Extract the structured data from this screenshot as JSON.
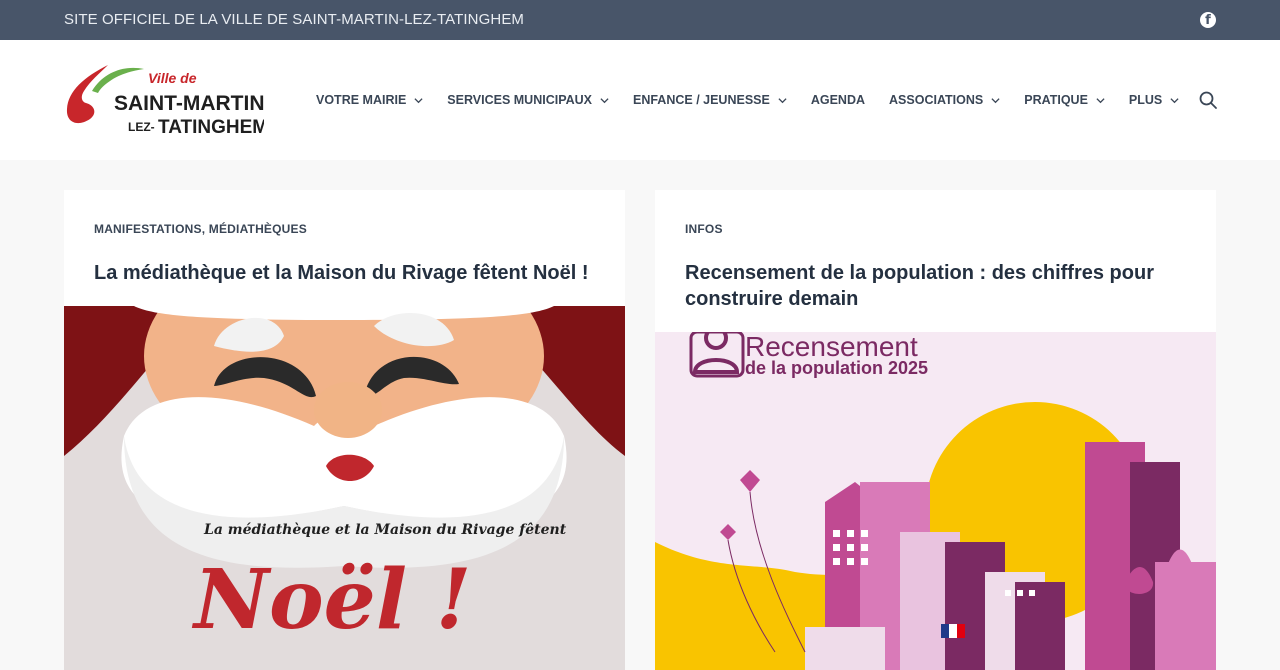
{
  "topbar": {
    "site_title": "SITE OFFICIEL DE LA VILLE DE SAINT-MARTIN-LEZ-TATINGHEM",
    "social_icon": "facebook-icon"
  },
  "header": {
    "logo": {
      "line1": "Ville de",
      "line2": "SAINT-MARTIN",
      "line3_prefix": "LEZ-",
      "line3": "TATINGHEM"
    },
    "nav": [
      {
        "label": "VOTRE MAIRIE",
        "has_dropdown": true
      },
      {
        "label": "SERVICES MUNICIPAUX",
        "has_dropdown": true
      },
      {
        "label": "ENFANCE / JEUNESSE",
        "has_dropdown": true
      },
      {
        "label": "AGENDA",
        "has_dropdown": false
      },
      {
        "label": "ASSOCIATIONS",
        "has_dropdown": true
      },
      {
        "label": "PRATIQUE",
        "has_dropdown": true
      },
      {
        "label": "PLUS",
        "has_dropdown": true
      }
    ],
    "search_icon": "search-icon"
  },
  "posts": [
    {
      "categories": [
        "MANIFESTATIONS",
        "MÉDIATHÈQUES"
      ],
      "separator": ", ",
      "title": "La médiathèque et la Maison du Rivage fêtent Noël !",
      "image": {
        "subtitle": "La médiathèque et la Maison du Rivage fêtent",
        "headline": "Noël !"
      }
    },
    {
      "categories": [
        "INFOS"
      ],
      "title": "Recensement de la population : des chiffres pour construire demain",
      "image": {
        "headline": "Recensement",
        "subline": "de la population 2025"
      }
    }
  ],
  "colors": {
    "topbar": "#485569",
    "logo_red": "#c8262b",
    "logo_green": "#6ab04c",
    "noel_red": "#c0272d",
    "census_purple": "#7b2a63",
    "census_yellow": "#f9c400"
  }
}
